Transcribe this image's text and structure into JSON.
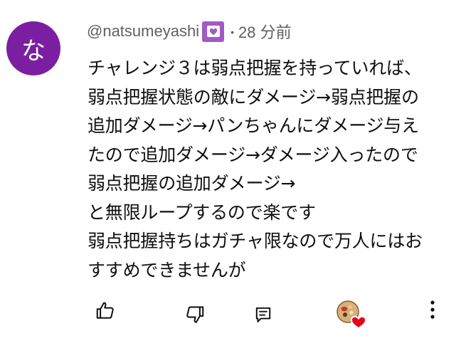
{
  "comment": {
    "avatar_letter": "な",
    "avatar_color": "#7b1fa2",
    "author": "@natsumeyashi",
    "member_badge_color": "#a259c6",
    "separator": "•",
    "time": "28 分前",
    "lines": [
      "チャレンジ３は弱点把握を持っていれば、",
      "弱点把握状態の敵にダメージ→弱点把握の",
      "追加ダメージ→パンちゃんにダメージ与え",
      "たので追加ダメージ→ダメージ入ったので",
      "弱点把握の追加ダメージ→",
      "と無限ループするので楽です",
      "弱点把握持ちはガチャ限なので万人にはお",
      "すすめできませんが"
    ]
  },
  "actions": {
    "like_icon": "thumbs-up-icon",
    "dislike_icon": "thumbs-down-icon",
    "reply_icon": "reply-icon",
    "creator_heart_icon": "creator-heart-icon",
    "more_icon": "more-vertical-icon",
    "heart_color": "#e8001c"
  }
}
